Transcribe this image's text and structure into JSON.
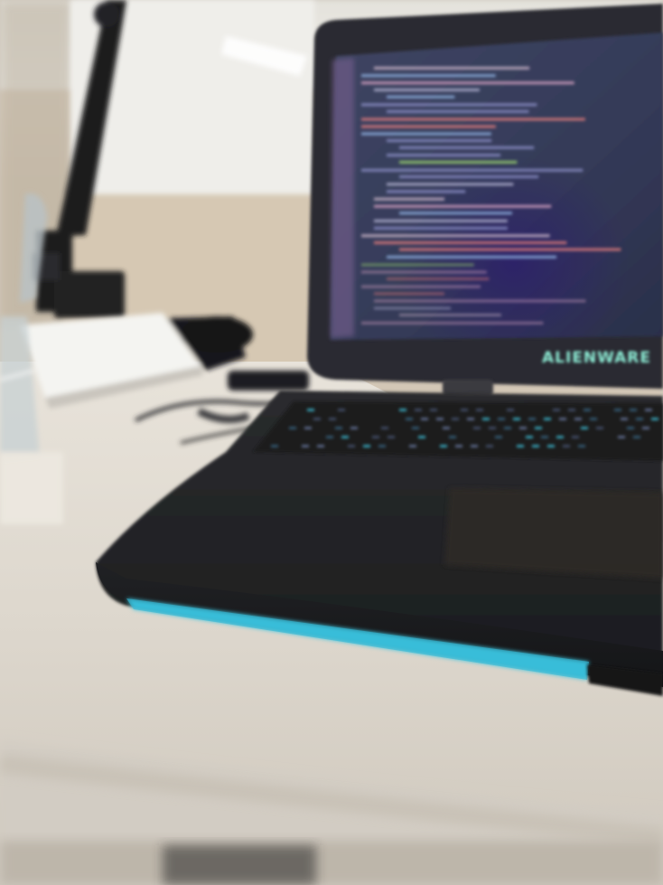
{
  "scene": {
    "laptop_brand": "ALIENWARE"
  },
  "colors": {
    "wall_upper": "#e9e7e1",
    "wall_lower": "#d7ccbc",
    "desk_surface": "#ddd6cb",
    "desk_shadow": "#bdb5a8",
    "laptop_body": "#232426",
    "laptop_bezel": "#2b2c31",
    "screen_bg": "#353c5a",
    "accent_light": "#3ec6e0",
    "brand_text": "#8ff0d8",
    "code_line_colors": [
      "#c9b3c7",
      "#8c8fc7",
      "#9bd36e",
      "#8fb0e0",
      "#d3a0c0",
      "#b0b0d0",
      "#e07a7a"
    ]
  },
  "icons": {
    "lamp": "desk-lamp",
    "glass": "drinking-glass",
    "papers": "paper-stack"
  }
}
